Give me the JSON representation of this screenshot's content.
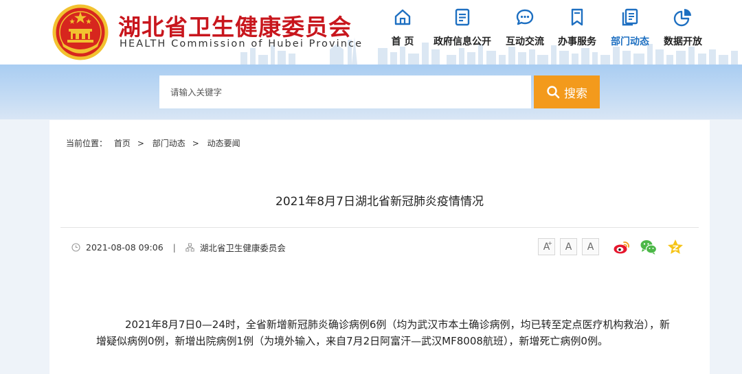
{
  "site": {
    "title": "湖北省卫生健康委员会",
    "subtitle": "HEALTH Commission of Hubei Province",
    "emblem_icon": "national-emblem-icon"
  },
  "nav": {
    "items": [
      {
        "label": "首 页",
        "icon": "home-icon"
      },
      {
        "label": "政府信息公开",
        "icon": "document-list-icon"
      },
      {
        "label": "互动交流",
        "icon": "chat-bubble-icon"
      },
      {
        "label": "办事服务",
        "icon": "bookmark-icon"
      },
      {
        "label": "部门动态",
        "icon": "copy-document-icon",
        "active": true
      },
      {
        "label": "数据开放",
        "icon": "pie-chart-icon"
      }
    ],
    "active_color": "#1d6fc1"
  },
  "search": {
    "placeholder": "请输入关键字",
    "button_label": "搜索",
    "button_color": "#f39a1c"
  },
  "breadcrumb": {
    "prefix": "当前位置：",
    "items": [
      "首页",
      "部门动态",
      "动态要闻"
    ],
    "separator": ">"
  },
  "article": {
    "title": "2021年8月7日湖北省新冠肺炎疫情情况",
    "date": "2021-08-08 09:06",
    "meta_separator": "|",
    "source": "湖北省卫生健康委员会",
    "font_size_buttons": [
      "A+",
      "A",
      "A-"
    ],
    "share_icons": [
      "weibo-icon",
      "wechat-icon",
      "favorite-star-icon"
    ],
    "body": "2021年8月7日0—24时，全省新增新冠肺炎确诊病例6例（均为武汉市本土确诊病例，均已转至定点医疗机构救治），新增疑似病例0例，新增出院病例1例（为境外输入，来自7月2日阿富汗—武汉MF8008航班），新增死亡病例0例。"
  },
  "colors": {
    "brand_red": "#c8161d",
    "banner_blue": "#a9cdf2"
  }
}
